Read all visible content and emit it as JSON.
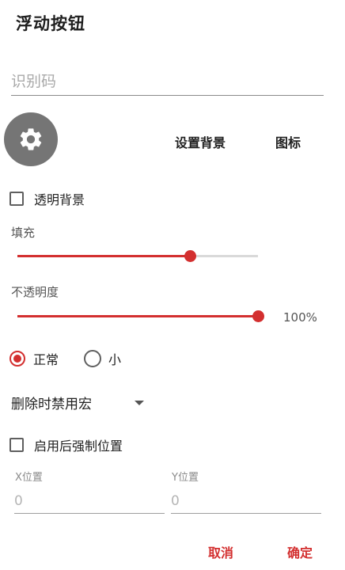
{
  "dialog": {
    "title": "浮动按钮"
  },
  "identifier": {
    "placeholder": "识别码",
    "value": ""
  },
  "appearance": {
    "set_background_label": "设置背景",
    "icon_label": "图标",
    "preview_icon": "gear-icon"
  },
  "transparent_bg": {
    "label": "透明背景",
    "checked": false
  },
  "fill": {
    "label": "填充",
    "level": 0.72
  },
  "opacity": {
    "label": "不透明度",
    "value_text": "100%",
    "level": 1.0
  },
  "size": {
    "options": [
      {
        "label": "正常",
        "selected": true
      },
      {
        "label": "小",
        "selected": false
      }
    ]
  },
  "delete_action": {
    "selected": "删除时禁用宏"
  },
  "force_position": {
    "label": "启用后强制位置",
    "checked": false
  },
  "position": {
    "x": {
      "label": "X位置",
      "placeholder": "0"
    },
    "y": {
      "label": "Y位置",
      "placeholder": "0"
    }
  },
  "actions": {
    "cancel_label": "取消",
    "confirm_label": "确定"
  },
  "colors": {
    "accent": "#d32f2f",
    "icon_bg": "#757575"
  }
}
